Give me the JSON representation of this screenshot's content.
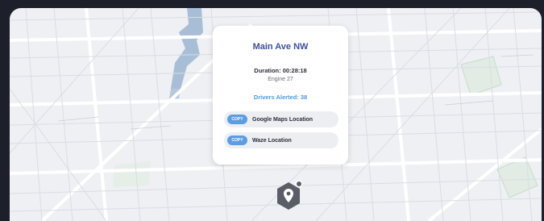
{
  "popup": {
    "title": "Main Ave NW",
    "duration": "Duration: 00:28:18",
    "unit": "Engine 27",
    "drivers_alerted": "Drivers Alerted: 38",
    "copy_rows": [
      {
        "badge": "COPY",
        "label": "Google Maps Location"
      },
      {
        "badge": "COPY",
        "label": "Waze Location"
      }
    ]
  },
  "map": {
    "pin_icon": "location-pin-icon",
    "colors": {
      "background": "#1d1f2b",
      "map_base": "#eef0f3",
      "water": "#a8bed6",
      "title": "#3f4fa0",
      "alert": "#4a9be0",
      "copy_badge": "#5c9de2",
      "pin": "#5a5d66"
    }
  }
}
